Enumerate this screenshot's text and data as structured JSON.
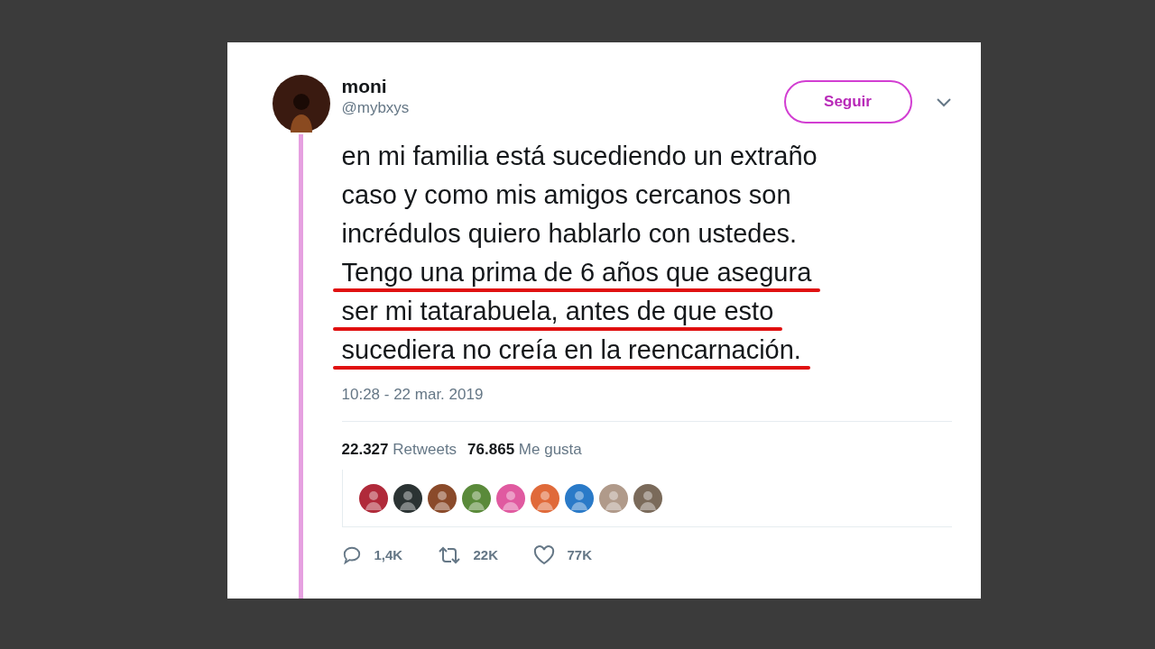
{
  "tweet": {
    "name": "moni",
    "handle": "@mybxys",
    "follow_button": "Seguir",
    "lines": [
      {
        "text": "en mi familia está sucediendo un extraño",
        "underlined": false
      },
      {
        "text": "caso y como mis amigos cercanos son",
        "underlined": false
      },
      {
        "text": "incrédulos quiero hablarlo con ustedes.",
        "underlined": false
      },
      {
        "text": "Tengo una prima de 6 años que asegura",
        "underlined": true
      },
      {
        "text": "ser mi tatarabuela, antes de que esto",
        "underlined": true
      },
      {
        "text": "sucediera no creía en la reencarnación.",
        "underlined": true
      }
    ],
    "timestamp": "10:28 - 22 mar. 2019",
    "stats": [
      {
        "count": "22.327",
        "label": "Retweets"
      },
      {
        "count": "76.865",
        "label": "Me gusta"
      }
    ],
    "likers": [
      {
        "color": "#b02a3a"
      },
      {
        "color": "#2b3333"
      },
      {
        "color": "#8a4a2a"
      },
      {
        "color": "#5a8a3a"
      },
      {
        "color": "#e05aa0"
      },
      {
        "color": "#e06a3a"
      },
      {
        "color": "#2a7ac8"
      },
      {
        "color": "#b09a8a"
      },
      {
        "color": "#7a6a5a"
      }
    ],
    "actions": [
      {
        "kind": "reply",
        "count": "1,4K"
      },
      {
        "kind": "retweet",
        "count": "22K"
      },
      {
        "kind": "like",
        "count": "77K"
      }
    ]
  }
}
